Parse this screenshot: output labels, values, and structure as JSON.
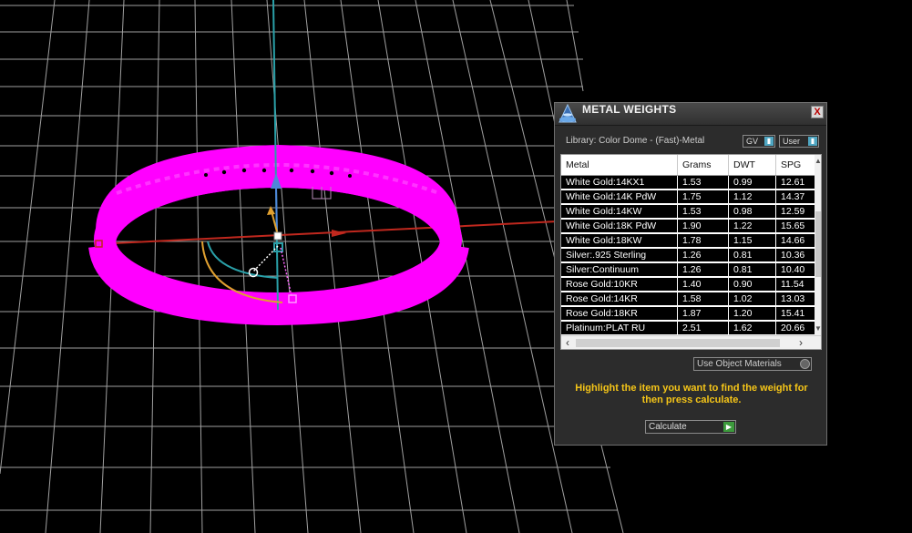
{
  "panel": {
    "title": "METAL WEIGHTS",
    "close_label": "X",
    "library_label": "Library: Color Dome - (Fast)-Metal",
    "toggles": {
      "gv": "GV",
      "user": "User"
    },
    "table": {
      "headers": [
        "Metal",
        "Grams",
        "DWT",
        "SPG"
      ],
      "rows": [
        [
          "White Gold:14KX1",
          "1.53",
          "0.99",
          "12.61"
        ],
        [
          "White Gold:14K PdW",
          "1.75",
          "1.12",
          "14.37"
        ],
        [
          "White Gold:14KW",
          "1.53",
          "0.98",
          "12.59"
        ],
        [
          "White Gold:18K PdW",
          "1.90",
          "1.22",
          "15.65"
        ],
        [
          "White Gold:18KW",
          "1.78",
          "1.15",
          "14.66"
        ],
        [
          "Silver:.925 Sterling",
          "1.26",
          "0.81",
          "10.36"
        ],
        [
          "Silver:Continuum",
          "1.26",
          "0.81",
          "10.40"
        ],
        [
          "Rose Gold:10KR",
          "1.40",
          "0.90",
          "11.54"
        ],
        [
          "Rose Gold:14KR",
          "1.58",
          "1.02",
          "13.03"
        ],
        [
          "Rose Gold:18KR",
          "1.87",
          "1.20",
          "15.41"
        ],
        [
          "Platinum:PLAT RU",
          "2.51",
          "1.62",
          "20.66"
        ]
      ]
    },
    "use_object_materials": "Use Object Materials",
    "hint": "Highlight the item you want to find the weight for then press calculate.",
    "calculate_label": "Calculate"
  },
  "colors": {
    "ring": "#ff00ff",
    "grid": "#bdbdbd",
    "hint": "#f5c518",
    "axis_x": "#c0281e",
    "axis_z": "#2aa0a8"
  }
}
